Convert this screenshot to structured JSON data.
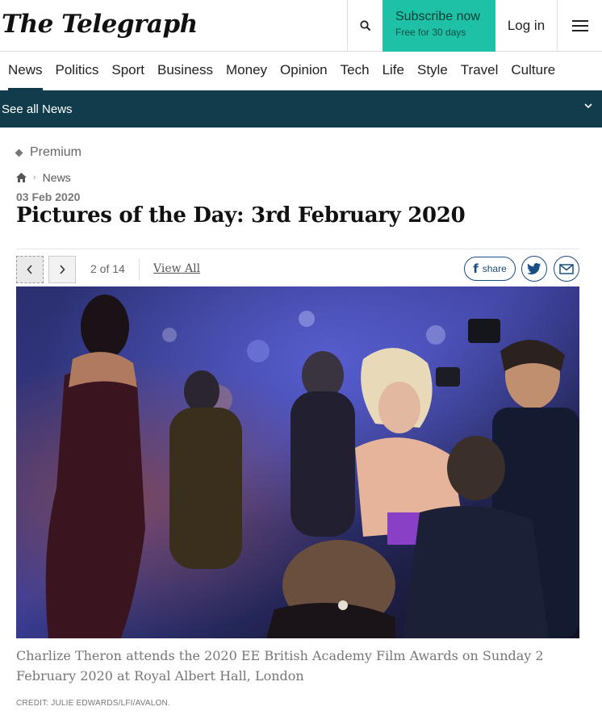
{
  "header": {
    "logo": "The Telegraph",
    "subscribe_label": "Subscribe now",
    "subscribe_sub": "Free for 30 days",
    "login_label": "Log in"
  },
  "nav": {
    "items": [
      "News",
      "Politics",
      "Sport",
      "Business",
      "Money",
      "Opinion",
      "Tech",
      "Life",
      "Style",
      "Travel",
      "Culture"
    ],
    "active": "News"
  },
  "subnav": {
    "label": "See all News"
  },
  "article": {
    "badge": "Premium",
    "breadcrumb": "News",
    "date": "03 Feb 2020",
    "title": "Pictures of the Day: 3rd February 2020"
  },
  "gallery": {
    "counter": "2 of 14",
    "view_all": "View All",
    "share_label": "share"
  },
  "photo": {
    "caption": "Charlize Theron attends the 2020 EE British Academy Film Awards on Sunday 2 February 2020 at Royal Albert Hall, London",
    "credit": "CREDIT: JULIE EDWARDS/LFI/AVALON."
  },
  "colors": {
    "accent": "#1ec1a6",
    "subnav_bg": "#103c4b",
    "share": "#1b4e83"
  }
}
